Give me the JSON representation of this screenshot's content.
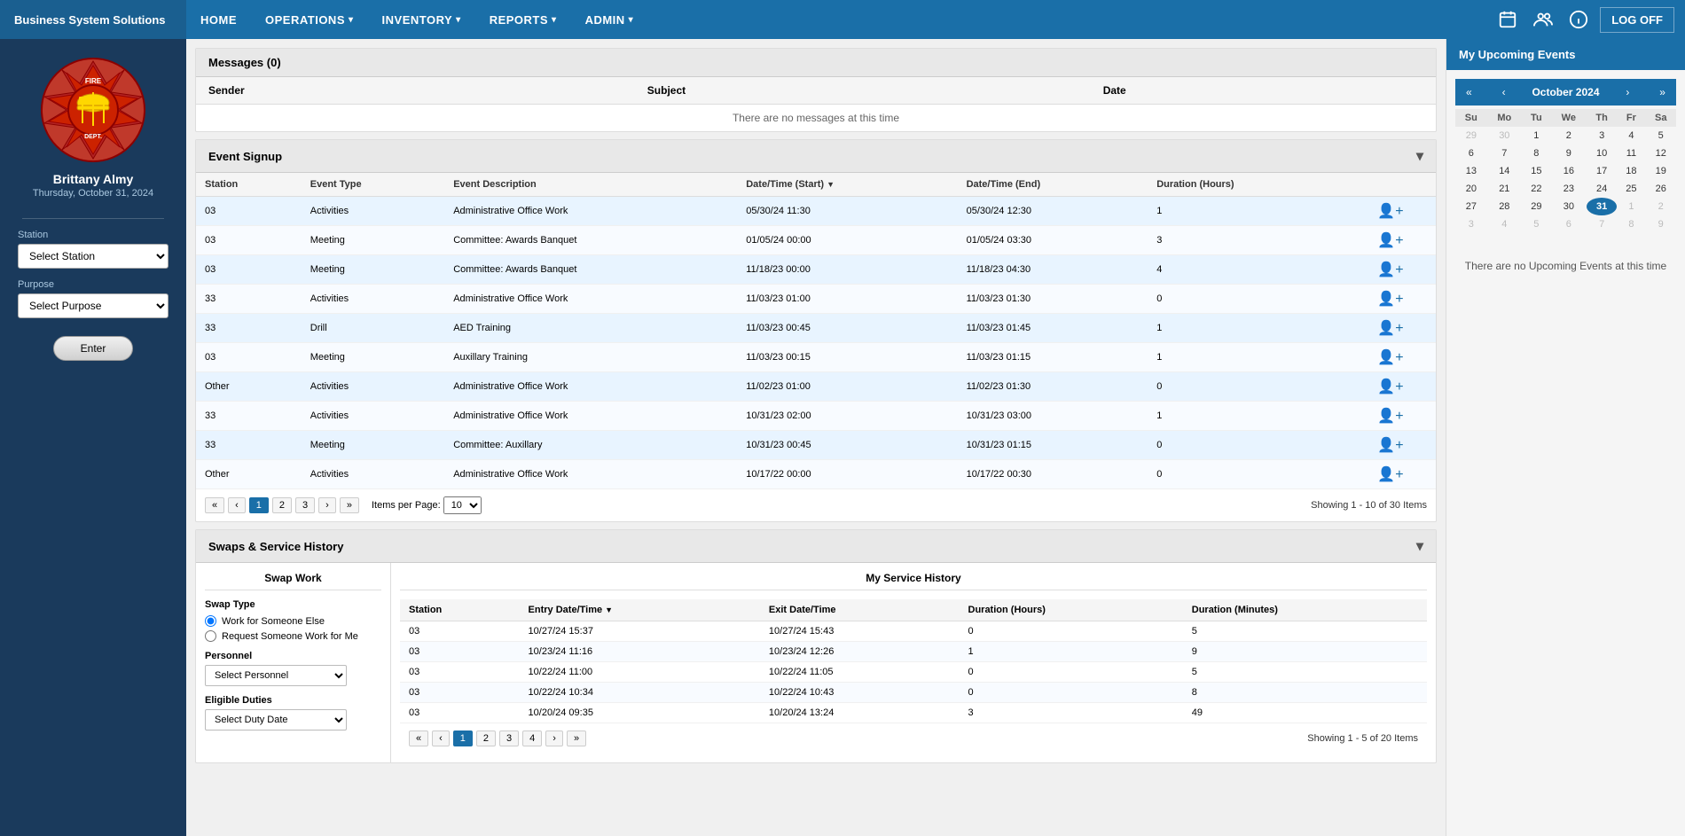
{
  "brand": "Business System Solutions",
  "nav": {
    "items": [
      {
        "label": "HOME",
        "hasDropdown": false
      },
      {
        "label": "OPERATIONS",
        "hasDropdown": true
      },
      {
        "label": "INVENTORY",
        "hasDropdown": true
      },
      {
        "label": "REPORTS",
        "hasDropdown": true
      },
      {
        "label": "ADMIN",
        "hasDropdown": true
      }
    ],
    "logoff": "LOG OFF"
  },
  "sidebar": {
    "userName": "Brittany Almy",
    "userDate": "Thursday, October 31, 2024",
    "stationLabel": "Station",
    "stationPlaceholder": "Select Station",
    "purposeLabel": "Purpose",
    "purposePlaceholder": "Select Purpose",
    "enterBtn": "Enter"
  },
  "messages": {
    "title": "Messages (0)",
    "columns": [
      "Sender",
      "Subject",
      "Date"
    ],
    "emptyText": "There are no messages at this time"
  },
  "eventSignup": {
    "title": "Event Signup",
    "columns": [
      "Station",
      "Event Type",
      "Event Description",
      "Date/Time (Start)",
      "Date/Time (End)",
      "Duration (Hours)"
    ],
    "rows": [
      {
        "station": "03",
        "type": "Activities",
        "description": "Administrative Office Work",
        "start": "05/30/24 11:30",
        "end": "05/30/24 12:30",
        "duration": "1"
      },
      {
        "station": "03",
        "type": "Meeting",
        "description": "Committee: Awards Banquet",
        "start": "01/05/24 00:00",
        "end": "01/05/24 03:30",
        "duration": "3"
      },
      {
        "station": "03",
        "type": "Meeting",
        "description": "Committee: Awards Banquet",
        "start": "11/18/23 00:00",
        "end": "11/18/23 04:30",
        "duration": "4"
      },
      {
        "station": "33",
        "type": "Activities",
        "description": "Administrative Office Work",
        "start": "11/03/23 01:00",
        "end": "11/03/23 01:30",
        "duration": "0"
      },
      {
        "station": "33",
        "type": "Drill",
        "description": "AED Training",
        "start": "11/03/23 00:45",
        "end": "11/03/23 01:45",
        "duration": "1"
      },
      {
        "station": "03",
        "type": "Meeting",
        "description": "Auxillary Training",
        "start": "11/03/23 00:15",
        "end": "11/03/23 01:15",
        "duration": "1"
      },
      {
        "station": "Other",
        "type": "Activities",
        "description": "Administrative Office Work",
        "start": "11/02/23 01:00",
        "end": "11/02/23 01:30",
        "duration": "0"
      },
      {
        "station": "33",
        "type": "Activities",
        "description": "Administrative Office Work",
        "start": "10/31/23 02:00",
        "end": "10/31/23 03:00",
        "duration": "1"
      },
      {
        "station": "33",
        "type": "Meeting",
        "description": "Committee: Auxillary",
        "start": "10/31/23 00:45",
        "end": "10/31/23 01:15",
        "duration": "0"
      },
      {
        "station": "Other",
        "type": "Activities",
        "description": "Administrative Office Work",
        "start": "10/17/22 00:00",
        "end": "10/17/22 00:30",
        "duration": "0"
      }
    ],
    "pagination": {
      "current": 1,
      "pages": [
        "1",
        "2",
        "3"
      ],
      "itemsPerPage": "10",
      "showing": "Showing 1 - 10 of 30 Items"
    }
  },
  "swaps": {
    "title": "Swaps & Service History",
    "swapWork": "Swap Work",
    "swapTypeLabel": "Swap Type",
    "workForSomeone": "Work for Someone Else",
    "requestSomeone": "Request Someone Work for Me",
    "personnelLabel": "Personnel",
    "personnelPlaceholder": "Select Personnel",
    "eligibleLabel": "Eligible Duties",
    "dutyDatePlaceholder": "Select Duty Date",
    "myServiceHistory": "My Service History",
    "serviceColumns": [
      "Station",
      "Entry Date/Time",
      "Exit Date/Time",
      "Duration (Hours)",
      "Duration (Minutes)"
    ],
    "serviceRows": [
      {
        "station": "03",
        "entry": "10/27/24 15:37",
        "exit": "10/27/24 15:43",
        "hours": "0",
        "minutes": "5"
      },
      {
        "station": "03",
        "entry": "10/23/24 11:16",
        "exit": "10/23/24 12:26",
        "hours": "1",
        "minutes": "9"
      },
      {
        "station": "03",
        "entry": "10/22/24 11:00",
        "exit": "10/22/24 11:05",
        "hours": "0",
        "minutes": "5"
      },
      {
        "station": "03",
        "entry": "10/22/24 10:34",
        "exit": "10/22/24 10:43",
        "hours": "0",
        "minutes": "8"
      },
      {
        "station": "03",
        "entry": "10/20/24 09:35",
        "exit": "10/20/24 13:24",
        "hours": "3",
        "minutes": "49"
      }
    ],
    "servicePagination": {
      "current": 1,
      "pages": [
        "1",
        "2",
        "3",
        "4"
      ],
      "showing": "Showing 1 - 5 of 20 Items"
    }
  },
  "rightPanel": {
    "title": "My Upcoming Events",
    "calendar": {
      "month": "October 2024",
      "dayHeaders": [
        "Su",
        "Mo",
        "Tu",
        "We",
        "Th",
        "Fr",
        "Sa"
      ],
      "weeks": [
        [
          {
            "day": "29",
            "other": true
          },
          {
            "day": "30",
            "other": true
          },
          {
            "day": "1"
          },
          {
            "day": "2"
          },
          {
            "day": "3"
          },
          {
            "day": "4"
          },
          {
            "day": "5"
          }
        ],
        [
          {
            "day": "6"
          },
          {
            "day": "7"
          },
          {
            "day": "8"
          },
          {
            "day": "9"
          },
          {
            "day": "10"
          },
          {
            "day": "11"
          },
          {
            "day": "12"
          }
        ],
        [
          {
            "day": "13"
          },
          {
            "day": "14"
          },
          {
            "day": "15"
          },
          {
            "day": "16"
          },
          {
            "day": "17"
          },
          {
            "day": "18"
          },
          {
            "day": "19"
          }
        ],
        [
          {
            "day": "20"
          },
          {
            "day": "21"
          },
          {
            "day": "22"
          },
          {
            "day": "23"
          },
          {
            "day": "24"
          },
          {
            "day": "25"
          },
          {
            "day": "26"
          }
        ],
        [
          {
            "day": "27"
          },
          {
            "day": "28"
          },
          {
            "day": "29"
          },
          {
            "day": "30"
          },
          {
            "day": "31",
            "today": true
          },
          {
            "day": "1",
            "other": true
          },
          {
            "day": "2",
            "other": true
          }
        ],
        [
          {
            "day": "3",
            "other": true
          },
          {
            "day": "4",
            "other": true
          },
          {
            "day": "5",
            "other": true
          },
          {
            "day": "6",
            "other": true
          },
          {
            "day": "7",
            "other": true
          },
          {
            "day": "8",
            "other": true
          },
          {
            "day": "9",
            "other": true
          }
        ]
      ],
      "noEventsText": "There are no Upcoming Events at this time"
    }
  }
}
